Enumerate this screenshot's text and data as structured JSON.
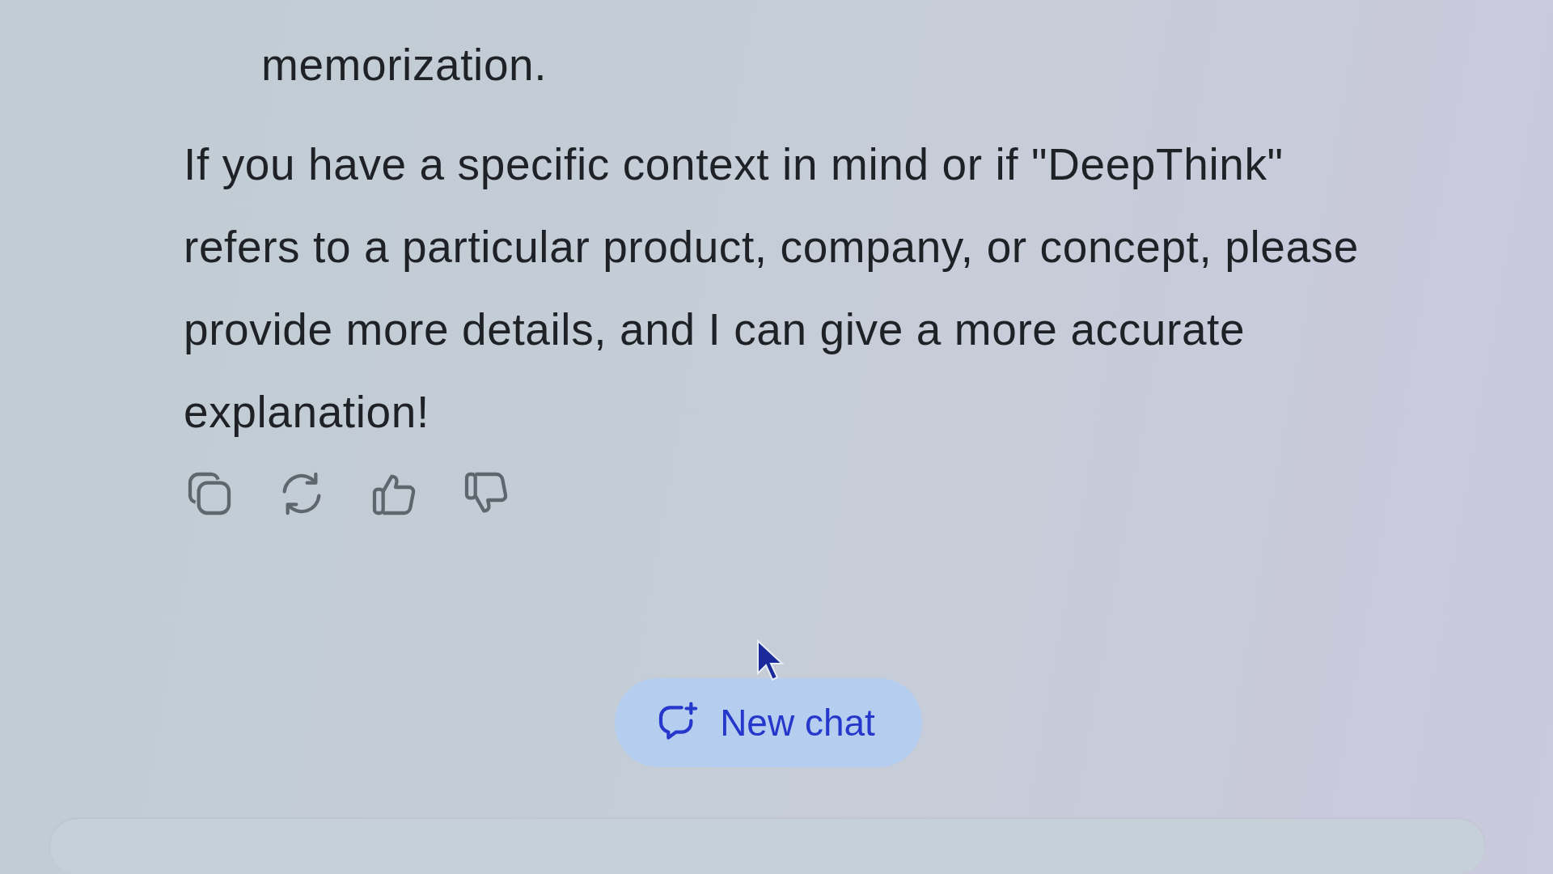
{
  "message": {
    "list_item_tail": "memorization.",
    "paragraph": "If you have a specific context in mind or if \"DeepThink\" refers to a particular product, company, or concept, please provide more details, and I can give a more accurate explanation!"
  },
  "actions": [
    {
      "kind": "copy"
    },
    {
      "kind": "regenerate"
    },
    {
      "kind": "like"
    },
    {
      "kind": "dislike"
    }
  ],
  "new_chat_button": {
    "label": "New chat"
  }
}
